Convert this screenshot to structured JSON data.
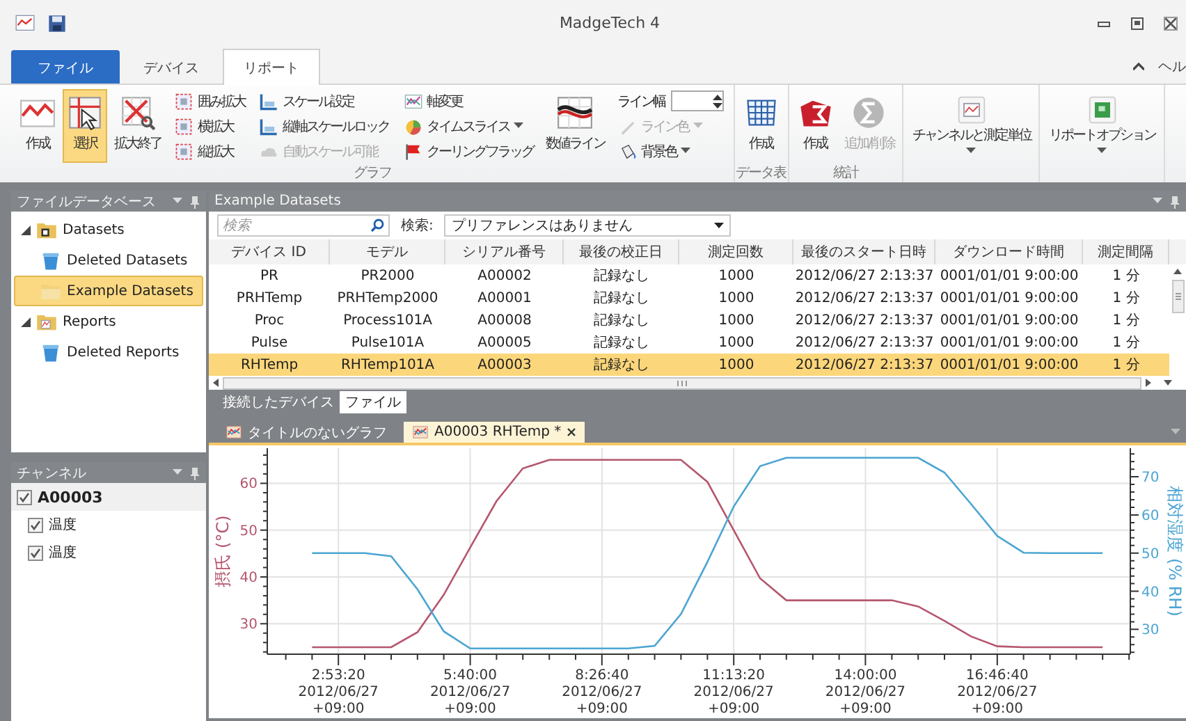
{
  "window": {
    "title": "MadgeTech 4"
  },
  "ribbon_tabs": [
    {
      "label": "ファイル",
      "kind": "file",
      "selected": false
    },
    {
      "label": "デバイス",
      "kind": "tab",
      "selected": false
    },
    {
      "label": "リポート",
      "kind": "tab",
      "selected": true
    }
  ],
  "help": "ヘル",
  "ribbon_groups": [
    {
      "label": "グラフ",
      "items": [
        {
          "kind": "large",
          "label": "作成",
          "selected": false
        },
        {
          "kind": "large",
          "label": "選択",
          "selected": true
        },
        {
          "kind": "large",
          "label": "拡大終了",
          "selected": false
        },
        {
          "kind": "stack",
          "items": [
            {
              "label": "囲み拡大"
            },
            {
              "label": "横拡大"
            },
            {
              "label": "縦拡大"
            }
          ]
        },
        {
          "kind": "stack",
          "items": [
            {
              "label": "スケール設定"
            },
            {
              "label": "縦軸スケールロック"
            },
            {
              "label": "自動スケール可能",
              "disabled": true
            }
          ]
        },
        {
          "kind": "stack",
          "items": [
            {
              "label": "軸変更"
            },
            {
              "label": "タイムスライス",
              "dropdown": true
            },
            {
              "label": "クーリングフラッグ"
            }
          ]
        },
        {
          "kind": "large",
          "label": "数値ライン",
          "selected": false
        },
        {
          "kind": "stack",
          "items": [
            {
              "kind": "spin",
              "label": "ライン幅"
            },
            {
              "label": "ライン色",
              "disabled": true,
              "dropdown": true
            },
            {
              "label": "背景色",
              "dropdown": true
            }
          ]
        }
      ]
    },
    {
      "label": "データ表",
      "items": [
        {
          "kind": "large",
          "label": "作成",
          "selected": false
        }
      ]
    },
    {
      "label": "統計",
      "items": [
        {
          "kind": "large",
          "label": "作成",
          "selected": false
        },
        {
          "kind": "large",
          "label": "追加/削除",
          "disabled": true,
          "selected": false
        }
      ]
    },
    {
      "items": [
        {
          "kind": "large",
          "label": "チャンネルと測定単位",
          "dropdown": true,
          "selected": false
        }
      ]
    },
    {
      "items": [
        {
          "kind": "large",
          "label": "リポートオプション",
          "dropdown": true,
          "selected": false
        }
      ]
    }
  ],
  "file_database": {
    "title": "ファイルデータベース",
    "items": [
      {
        "label": "Datasets",
        "kind": "datasets-folder",
        "expanded": true,
        "selected": false,
        "children": [
          {
            "label": "Deleted Datasets",
            "kind": "trash",
            "selected": false
          },
          {
            "label": "Example Datasets",
            "kind": "folder",
            "selected": true
          }
        ]
      },
      {
        "label": "Reports",
        "kind": "reports-folder",
        "expanded": true,
        "selected": false,
        "children": [
          {
            "label": "Deleted Reports",
            "kind": "trash",
            "selected": false
          }
        ]
      }
    ]
  },
  "channels": {
    "title": "チャンネル",
    "items": [
      {
        "label": "A00003",
        "checked": true,
        "children": [
          {
            "label": "温度",
            "checked": true
          },
          {
            "label": "温度",
            "checked": true
          }
        ]
      }
    ]
  },
  "datasets": {
    "title": "Example Datasets",
    "search": {
      "placeholder": "検索"
    },
    "filter_label": "検索:",
    "filter_value": "プリファレンスはありません",
    "columns": [
      "デバイス ID",
      "モデル",
      "シリアル番号",
      "最後の校正日",
      "測定回数",
      "最後のスタート日時",
      "ダウンロード時間",
      "測定間隔"
    ],
    "rows": [
      {
        "cells": [
          "PR",
          "PR2000",
          "A00002",
          "記録なし",
          "1000",
          "2012/06/27 2:13:37",
          "0001/01/01 9:00:00",
          "1 分"
        ],
        "selected": false
      },
      {
        "cells": [
          "PRHTemp",
          "PRHTemp2000",
          "A00001",
          "記録なし",
          "1000",
          "2012/06/27 2:13:37",
          "0001/01/01 9:00:00",
          "1 分"
        ],
        "selected": false
      },
      {
        "cells": [
          "Proc",
          "Process101A",
          "A00008",
          "記録なし",
          "1000",
          "2012/06/27 2:13:37",
          "0001/01/01 9:00:00",
          "1 分"
        ],
        "selected": false
      },
      {
        "cells": [
          "Pulse",
          "Pulse101A",
          "A00005",
          "記録なし",
          "1000",
          "2012/06/27 2:13:37",
          "0001/01/01 9:00:00",
          "1 分"
        ],
        "selected": false
      },
      {
        "cells": [
          "RHTemp",
          "RHTemp101A",
          "A00003",
          "記録なし",
          "1000",
          "2012/06/27 2:13:37",
          "0001/01/01 9:00:00",
          "1 分"
        ],
        "selected": true
      }
    ]
  },
  "bottom_tabs": [
    {
      "label": "接続したデバイス",
      "selected": false
    },
    {
      "label": "ファイル",
      "selected": true
    }
  ],
  "graph_tabs": [
    {
      "label": "タイトルのないグラフ",
      "selected": false
    },
    {
      "label": "A00003 RHTemp *",
      "selected": true
    }
  ],
  "graph": {
    "chart_data": {
      "type": "line",
      "ylabel": "摂氏 (°C)",
      "y2label": "相対湿度 (% RH)",
      "categories": [
        null,
        "2:53:20\n2012/06/27\n+09:00",
        null,
        null,
        null,
        null,
        "5:40:00\n2012/06/27\n+09:00",
        null,
        null,
        null,
        null,
        "8:26:40\n2012/06/27\n+09:00",
        null,
        null,
        null,
        null,
        "11:13:20\n2012/06/27\n+09:00",
        null,
        null,
        null,
        null,
        "14:00:00\n2012/06/27\n+09:00",
        null,
        null,
        null,
        null,
        "16:46:40\n2012/06/27\n+09:00",
        null,
        null,
        null,
        null
      ],
      "grid": true,
      "ylim": [
        23.5,
        67.5
      ],
      "y2lim": [
        23.5,
        77.5
      ],
      "yticks": [
        30,
        40,
        50,
        60
      ],
      "y2ticks": [
        30,
        40,
        50,
        60,
        70
      ],
      "series": [
        {
          "color": "#b5566e",
          "axis": "y",
          "values": [
            25,
            25,
            25,
            25,
            28.2,
            36.2,
            46.3,
            56.2,
            63.2,
            65,
            65,
            65,
            65,
            65,
            65,
            60.3,
            50,
            39.7,
            35,
            35,
            35,
            35,
            35,
            33.7,
            30.6,
            27.3,
            25.2,
            25,
            25,
            25,
            25
          ]
        },
        {
          "color": "#4ba5d2",
          "axis": "y2",
          "values": [
            50,
            50,
            50,
            49.2,
            40.5,
            29.5,
            25,
            25,
            25,
            25,
            25,
            25,
            25,
            25.7,
            34,
            47.7,
            62.2,
            72.8,
            75,
            75,
            75,
            75,
            75,
            75,
            71.1,
            62.9,
            54.5,
            50.1,
            50,
            50,
            50
          ]
        }
      ]
    }
  }
}
